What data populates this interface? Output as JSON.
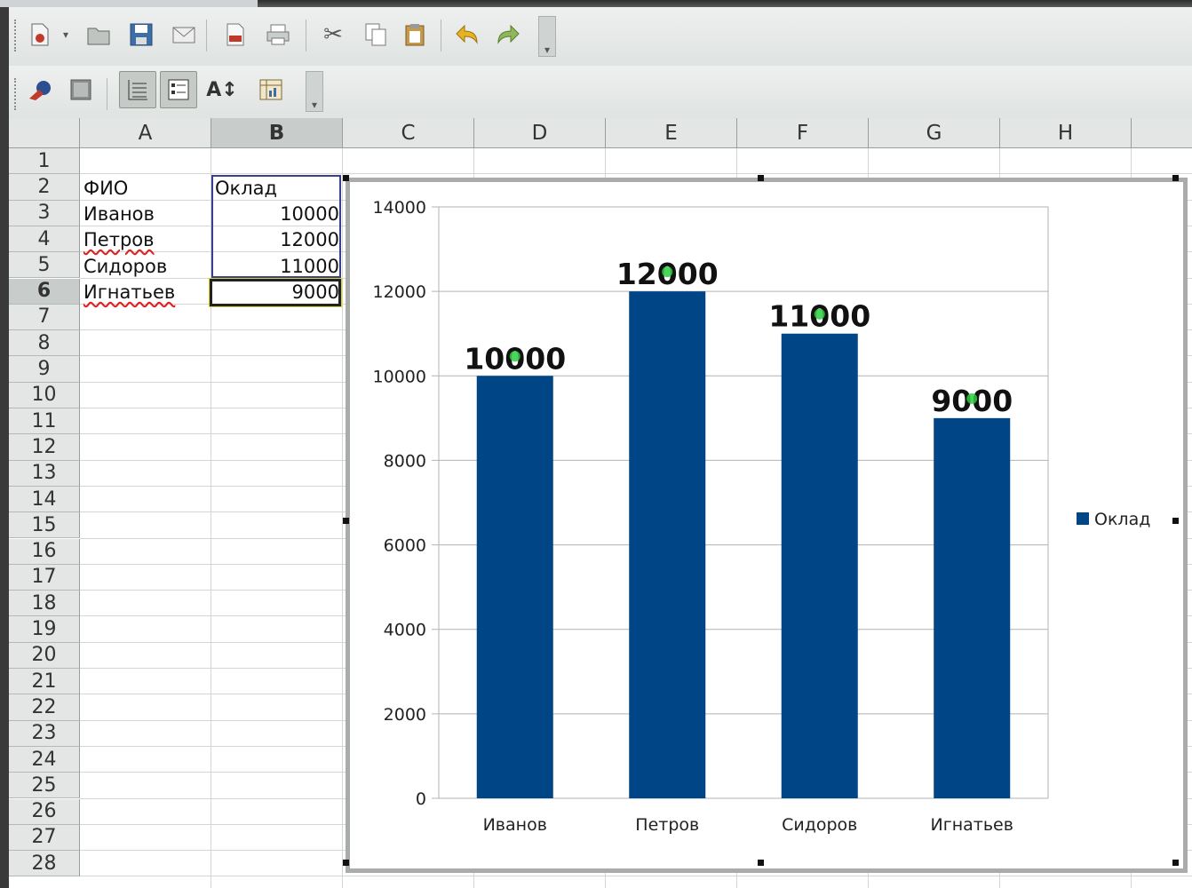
{
  "toolbar1": {
    "icons": [
      "new-document-icon",
      "dropdown-arrow-icon",
      "open-folder-icon",
      "save-icon",
      "email-icon",
      "export-pdf-icon",
      "print-icon",
      "cut-icon",
      "copy-icon",
      "paste-icon",
      "undo-icon",
      "redo-icon",
      "toolbar-overflow-icon"
    ]
  },
  "toolbar2": {
    "icons": [
      "chart-wall-icon",
      "chart-area-icon",
      "horizontal-gridlines-icon",
      "legend-toggle-icon",
      "scale-text-icon",
      "data-table-icon",
      "toolbar-overflow-icon"
    ]
  },
  "sheet": {
    "column_headers": [
      "A",
      "B",
      "C",
      "D",
      "E",
      "F",
      "G",
      "H"
    ],
    "selected_column": "B",
    "row_numbers": [
      "1",
      "2",
      "3",
      "4",
      "5",
      "6",
      "7",
      "8",
      "9",
      "10",
      "11",
      "12",
      "13",
      "14",
      "15",
      "16",
      "17",
      "18",
      "19",
      "20",
      "21",
      "22",
      "23",
      "24",
      "25",
      "26",
      "27",
      "28"
    ],
    "selected_row": "6",
    "header_row": {
      "name": "ФИО",
      "salary": "Оклад"
    },
    "rows": [
      {
        "name": "Иванов",
        "salary": "10000"
      },
      {
        "name": "Петров",
        "salary": "12000"
      },
      {
        "name": "Сидоров",
        "salary": "11000"
      },
      {
        "name": "Игнатьев",
        "salary": "9000"
      }
    ]
  },
  "chart_data": {
    "type": "bar",
    "categories": [
      "Иванов",
      "Петров",
      "Сидоров",
      "Игнатьев"
    ],
    "series": [
      {
        "name": "Оклад",
        "values": [
          10000,
          12000,
          11000,
          9000
        ]
      }
    ],
    "data_labels": [
      "10000",
      "12000",
      "11000",
      "9000"
    ],
    "yticks": [
      "0",
      "2000",
      "4000",
      "6000",
      "8000",
      "10000",
      "12000",
      "14000"
    ],
    "ylim": [
      0,
      14000
    ],
    "grid": true,
    "legend_position": "right",
    "bar_color": "#004586",
    "title": "",
    "xlabel": "",
    "ylabel": ""
  }
}
